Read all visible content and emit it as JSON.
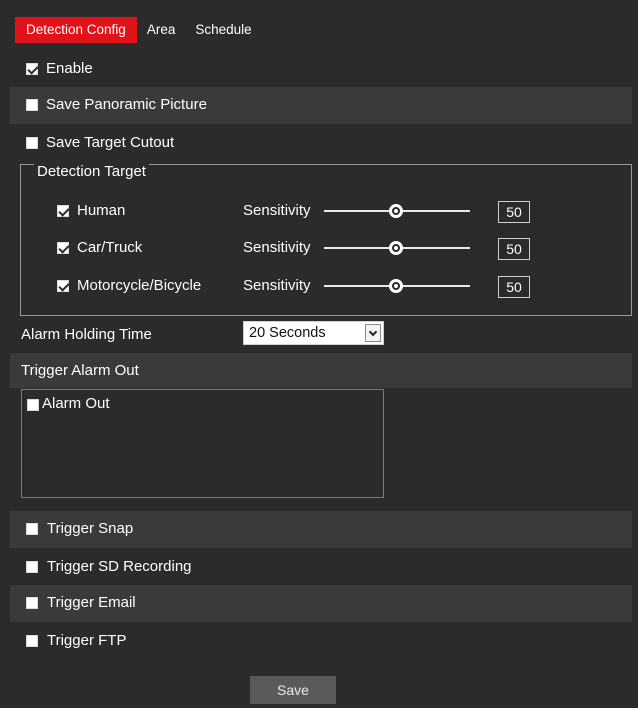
{
  "tabs": [
    {
      "label": "Detection Config",
      "active": true
    },
    {
      "label": "Area",
      "active": false
    },
    {
      "label": "Schedule",
      "active": false
    }
  ],
  "options": {
    "enable": {
      "label": "Enable",
      "checked": true
    },
    "save_panoramic": {
      "label": "Save Panoramic Picture",
      "checked": false
    },
    "save_target_cutout": {
      "label": "Save Target Cutout",
      "checked": false
    }
  },
  "detection_target": {
    "legend": "Detection Target",
    "items": [
      {
        "label": "Human",
        "checked": true,
        "sensitivity_label": "Sensitivity",
        "value": "50"
      },
      {
        "label": "Car/Truck",
        "checked": true,
        "sensitivity_label": "Sensitivity",
        "value": "50"
      },
      {
        "label": "Motorcycle/Bicycle",
        "checked": true,
        "sensitivity_label": "Sensitivity",
        "value": "50"
      }
    ]
  },
  "alarm_holding": {
    "label": "Alarm Holding Time",
    "value": "20 Seconds"
  },
  "trigger_alarm_out": {
    "label": "Trigger Alarm Out",
    "items": [
      {
        "label": "Alarm Out",
        "checked": false
      }
    ]
  },
  "triggers": {
    "snap": {
      "label": "Trigger Snap",
      "checked": false
    },
    "sd_recording": {
      "label": "Trigger SD Recording",
      "checked": false
    },
    "email": {
      "label": "Trigger Email",
      "checked": false
    },
    "ftp": {
      "label": "Trigger FTP",
      "checked": false
    }
  },
  "save_label": "Save",
  "colors": {
    "accent": "#e0121a",
    "background": "#2b2b2b",
    "band": "#3a3a3a"
  }
}
